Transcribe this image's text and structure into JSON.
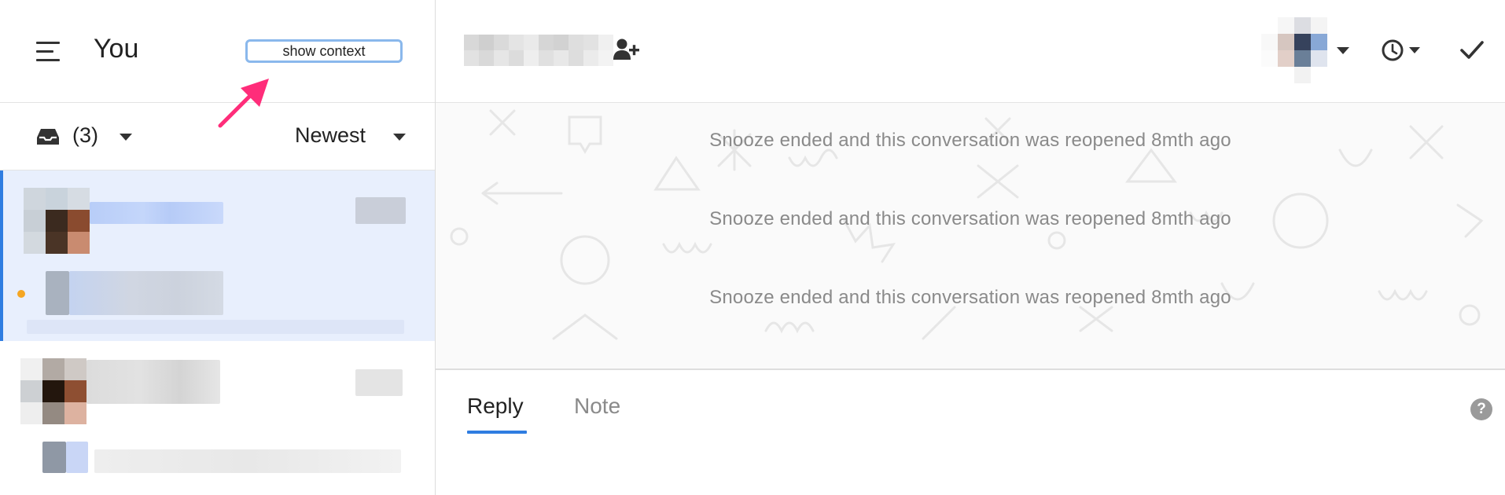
{
  "left_header": {
    "title": "You",
    "show_context_label": "show context",
    "menu_icon": "hamburger-icon",
    "annotation_arrow_color": "#ff2d7a"
  },
  "filter_bar": {
    "inbox_icon": "inbox-tray-icon",
    "inbox_count": "(3)",
    "sort_label": "Newest"
  },
  "conversation_list": {
    "active_bg": "#e8effd",
    "active_accent": "#2f7de1",
    "unread_dot_color": "#f5a623"
  },
  "header": {
    "add_participant_icon": "add-person-icon",
    "snooze_icon": "clock-icon",
    "resolve_icon": "checkmark-icon"
  },
  "conversation": {
    "events": [
      "Snooze ended and this conversation was reopened 8mth ago",
      "Snooze ended and this conversation was reopened 8mth ago",
      "Snooze ended and this conversation was reopened 8mth ago"
    ]
  },
  "composer": {
    "tabs": [
      "Reply",
      "Note"
    ],
    "active_tab": "Reply",
    "help_label": "?",
    "accent": "#2f7de1"
  }
}
